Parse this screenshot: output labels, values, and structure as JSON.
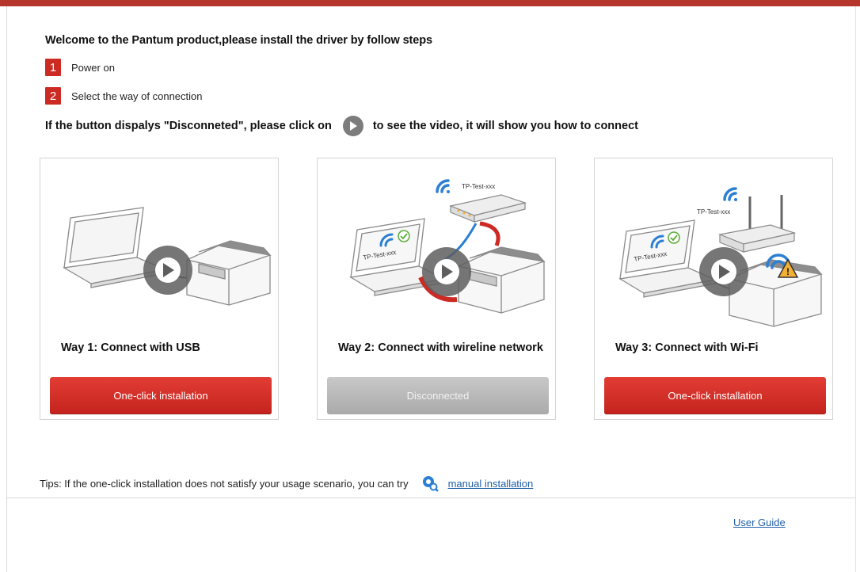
{
  "header": {
    "welcome": "Welcome to the Pantum product,please install the driver by follow steps"
  },
  "steps": [
    {
      "num": "1",
      "text": "Power on"
    },
    {
      "num": "2",
      "text": "Select the way of connection"
    }
  ],
  "hint": {
    "before": "If the button dispalys \"Disconneted\", please click on",
    "after": "to see the video, it will show you how to connect"
  },
  "ways": [
    {
      "title": "Way 1: Connect with USB",
      "button": "One-click installation",
      "button_state": "enabled"
    },
    {
      "title": "Way 2: Connect with wireline network",
      "button": "Disconnected",
      "button_state": "disabled",
      "ssid": "TP-Test-xxx",
      "laptop_ssid": "TP-Test-xxx"
    },
    {
      "title": "Way 3: Connect with Wi-Fi",
      "button": "One-click installation",
      "button_state": "enabled",
      "ssid": "TP-Test-xxx",
      "laptop_ssid": "TP-Test-xxx"
    }
  ],
  "tips": {
    "text": "Tips: If the one-click installation does not satisfy your usage scenario, you can try",
    "link": "manual installation"
  },
  "footer": {
    "user_guide": "User Guide"
  },
  "colors": {
    "brand_red": "#cc2b24",
    "disabled_gray": "#b4b4b4",
    "link_blue": "#1f5fa8",
    "wifi_blue": "#2b7fd4"
  },
  "icons": [
    "play-icon",
    "wifi-icon",
    "check-icon",
    "warning-icon",
    "gear-search-icon"
  ]
}
